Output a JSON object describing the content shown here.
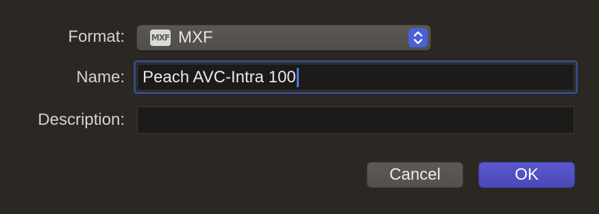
{
  "form": {
    "format_label": "Format:",
    "name_label": "Name:",
    "description_label": "Description:"
  },
  "format_popup": {
    "icon_name": "mxf-file-icon",
    "icon_text": "MXF",
    "selected_value": "MXF"
  },
  "name_field": {
    "value": "Peach AVC-Intra 100"
  },
  "description_field": {
    "value": ""
  },
  "buttons": {
    "cancel_label": "Cancel",
    "ok_label": "OK"
  },
  "colors": {
    "background": "#2b2723",
    "accent": "#4b5fd6",
    "default_button": "#5252c4",
    "focus_ring": "#334c8a"
  }
}
